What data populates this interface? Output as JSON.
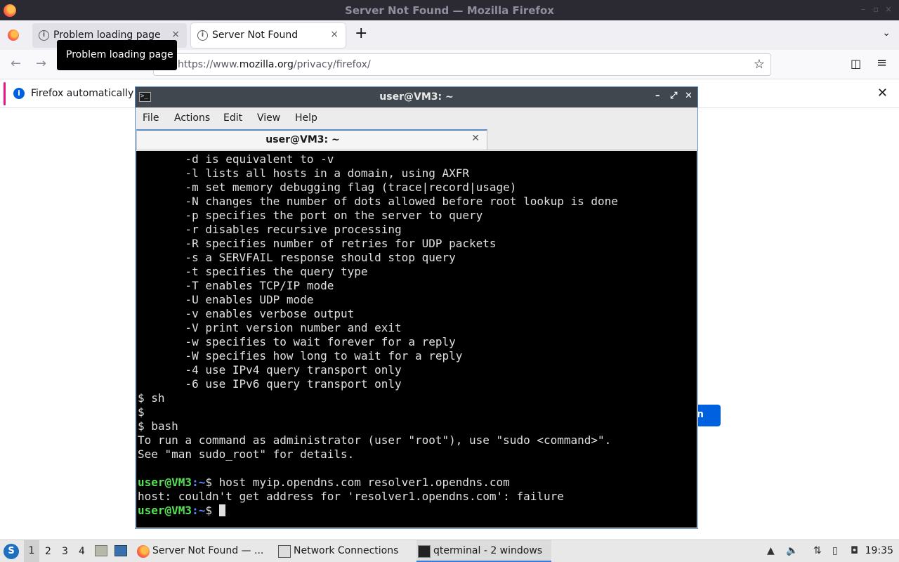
{
  "firefox": {
    "window_title": "Server Not Found — Mozilla Firefox",
    "tabs": [
      {
        "label": "Problem loading page",
        "close": "×"
      },
      {
        "label": "Server Not Found",
        "close": "×"
      }
    ],
    "new_tab": "+",
    "tooltip": "Problem loading page",
    "url_prefix": "https://www.",
    "url_domain": "mozilla.org",
    "url_suffix": "/privacy/firefox/",
    "notification": "Firefox automatically s",
    "hidden_button_text": "n"
  },
  "terminal": {
    "title": "user@VM3: ~",
    "menu": [
      "File",
      "Actions",
      "Edit",
      "View",
      "Help"
    ],
    "tab_label": "user@VM3: ~",
    "lines": [
      "       -d is equivalent to -v",
      "       -l lists all hosts in a domain, using AXFR",
      "       -m set memory debugging flag (trace|record|usage)",
      "       -N changes the number of dots allowed before root lookup is done",
      "       -p specifies the port on the server to query",
      "       -r disables recursive processing",
      "       -R specifies number of retries for UDP packets",
      "       -s a SERVFAIL response should stop query",
      "       -t specifies the query type",
      "       -T enables TCP/IP mode",
      "       -U enables UDP mode",
      "       -v enables verbose output",
      "       -V print version number and exit",
      "       -w specifies to wait forever for a reply",
      "       -W specifies how long to wait for a reply",
      "       -4 use IPv4 query transport only",
      "       -6 use IPv6 query transport only",
      "$ sh",
      "$",
      "$ bash",
      "To run a command as administrator (user \"root\"), use \"sudo <command>\".",
      "See \"man sudo_root\" for details.",
      ""
    ],
    "prompt_user": "user@VM3",
    "prompt_path": ":~",
    "prompt_sym": "$ ",
    "command": "host myip.opendns.com resolver1.opendns.com",
    "error_line": "host: couldn't get address for 'resolver1.opendns.com': failure"
  },
  "taskbar": {
    "workspaces": [
      "1",
      "2",
      "3",
      "4"
    ],
    "tasks": [
      {
        "label": "Server Not Found — ..."
      },
      {
        "label": "Network Connections"
      },
      {
        "label": "qterminal - 2 windows"
      }
    ],
    "clock": "19:35"
  }
}
